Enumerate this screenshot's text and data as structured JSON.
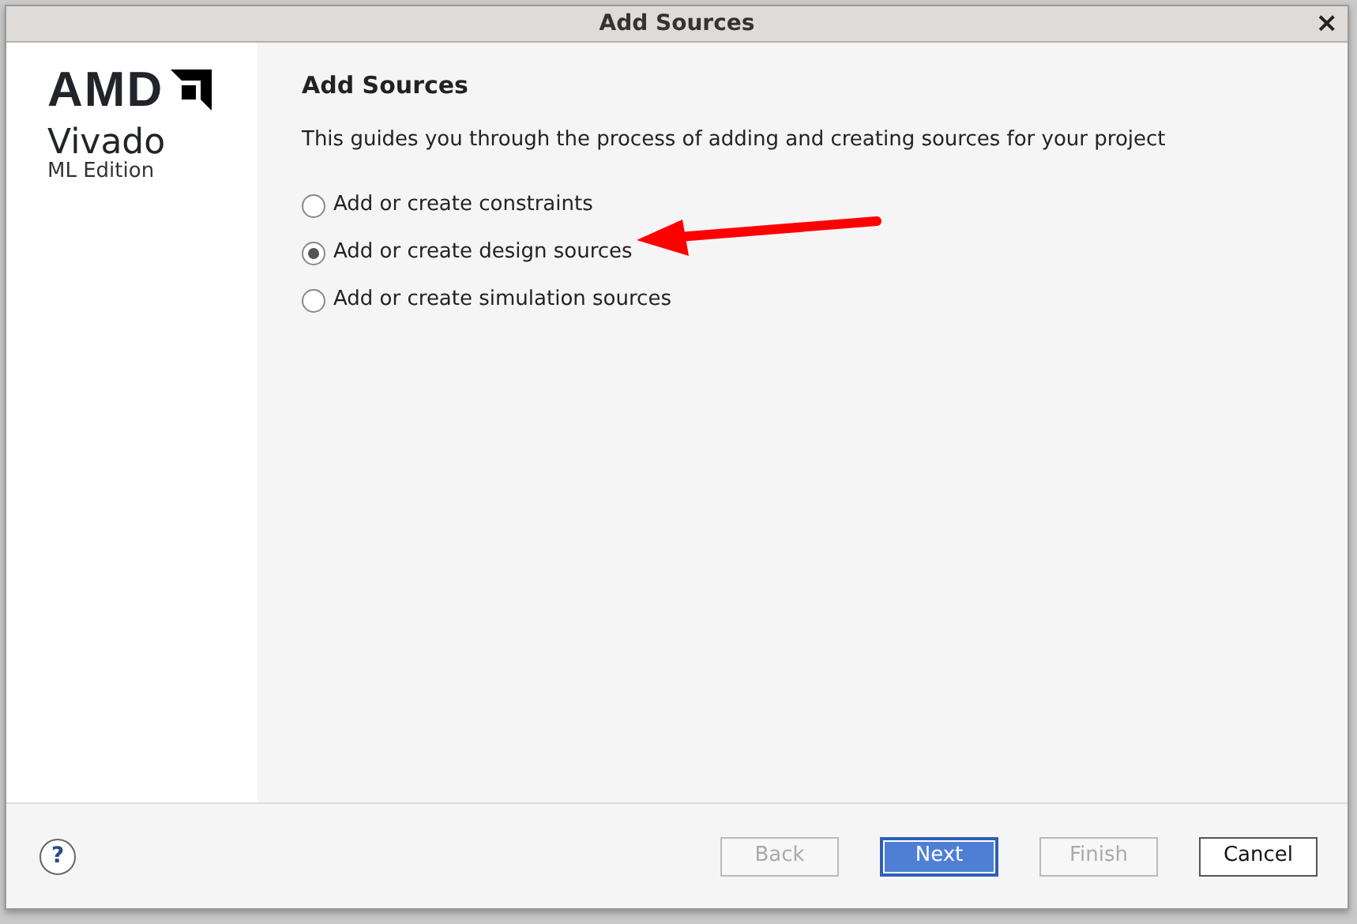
{
  "window": {
    "title": "Add Sources",
    "close": "×"
  },
  "logo": {
    "brand": "AMD",
    "product": "Vivado",
    "edition": "ML Edition"
  },
  "page": {
    "heading": "Add Sources",
    "description": "This guides you through the process of adding and creating sources for your project"
  },
  "options": [
    {
      "label": "Add or create constraints",
      "selected": false
    },
    {
      "label": "Add or create design sources",
      "selected": true
    },
    {
      "label": "Add or create simulation sources",
      "selected": false
    }
  ],
  "help": "?",
  "buttons": [
    {
      "label": "Back",
      "disabled": true,
      "default": false
    },
    {
      "label": "Next",
      "disabled": false,
      "default": true
    },
    {
      "label": "Finish",
      "disabled": true,
      "default": false
    },
    {
      "label": "Cancel",
      "disabled": false,
      "default": false
    }
  ]
}
